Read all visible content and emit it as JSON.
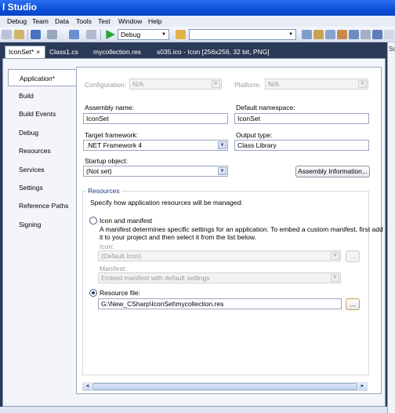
{
  "window": {
    "title": "l Studio"
  },
  "menu": [
    "Debug",
    "Team",
    "Data",
    "Tools",
    "Test",
    "Window",
    "Help"
  ],
  "toolbar": {
    "config": "Debug",
    "search": ""
  },
  "tabs": [
    {
      "label": "IconSet*",
      "active": true
    },
    {
      "label": "Class1.cs",
      "active": false
    },
    {
      "label": "mycollection.res",
      "active": false
    },
    {
      "label": "s035.ico - Icon [256x256, 32 bit, PNG]",
      "active": false
    }
  ],
  "right_dock": {
    "label": "Sc"
  },
  "nav": [
    {
      "label": "Application*",
      "active": true
    },
    {
      "label": "Build"
    },
    {
      "label": "Build Events"
    },
    {
      "label": "Debug"
    },
    {
      "label": "Resources"
    },
    {
      "label": "Services"
    },
    {
      "label": "Settings"
    },
    {
      "label": "Reference Paths"
    },
    {
      "label": "Signing"
    }
  ],
  "app": {
    "configuration_label": "Configuration:",
    "configuration_value": "N/A",
    "platform_label": "Platform:",
    "platform_value": "N/A",
    "assembly_name_label": "Assembly name:",
    "assembly_name": "IconSet",
    "default_namespace_label": "Default namespace:",
    "default_namespace": "IconSet",
    "target_framework_label": "Target framework:",
    "target_framework": ".NET Framework 4",
    "output_type_label": "Output type:",
    "output_type": "Class Library",
    "startup_object_label": "Startup object:",
    "startup_object": "(Not set)",
    "assembly_info_button": "Assembly Information...",
    "resources_title": "Resources",
    "resources_desc": "Specify how application resources will be managed:",
    "icon_manifest_label": "Icon and manifest",
    "icon_manifest_desc_1": "A manifest determines specific settings for an application. To embed a custom manifest, first add",
    "icon_manifest_desc_2": "it to your project and then select it from the list below.",
    "icon_label": "Icon:",
    "icon_value": "(Default Icon)",
    "browse_icon": "...",
    "manifest_label": "Manifest:",
    "manifest_value": "Embed manifest with default settings",
    "resource_file_label": "Resource file:",
    "resource_file_value": "G:\\New_CSharp\\IconSet\\mycollection.res",
    "browse_resource": "..."
  }
}
